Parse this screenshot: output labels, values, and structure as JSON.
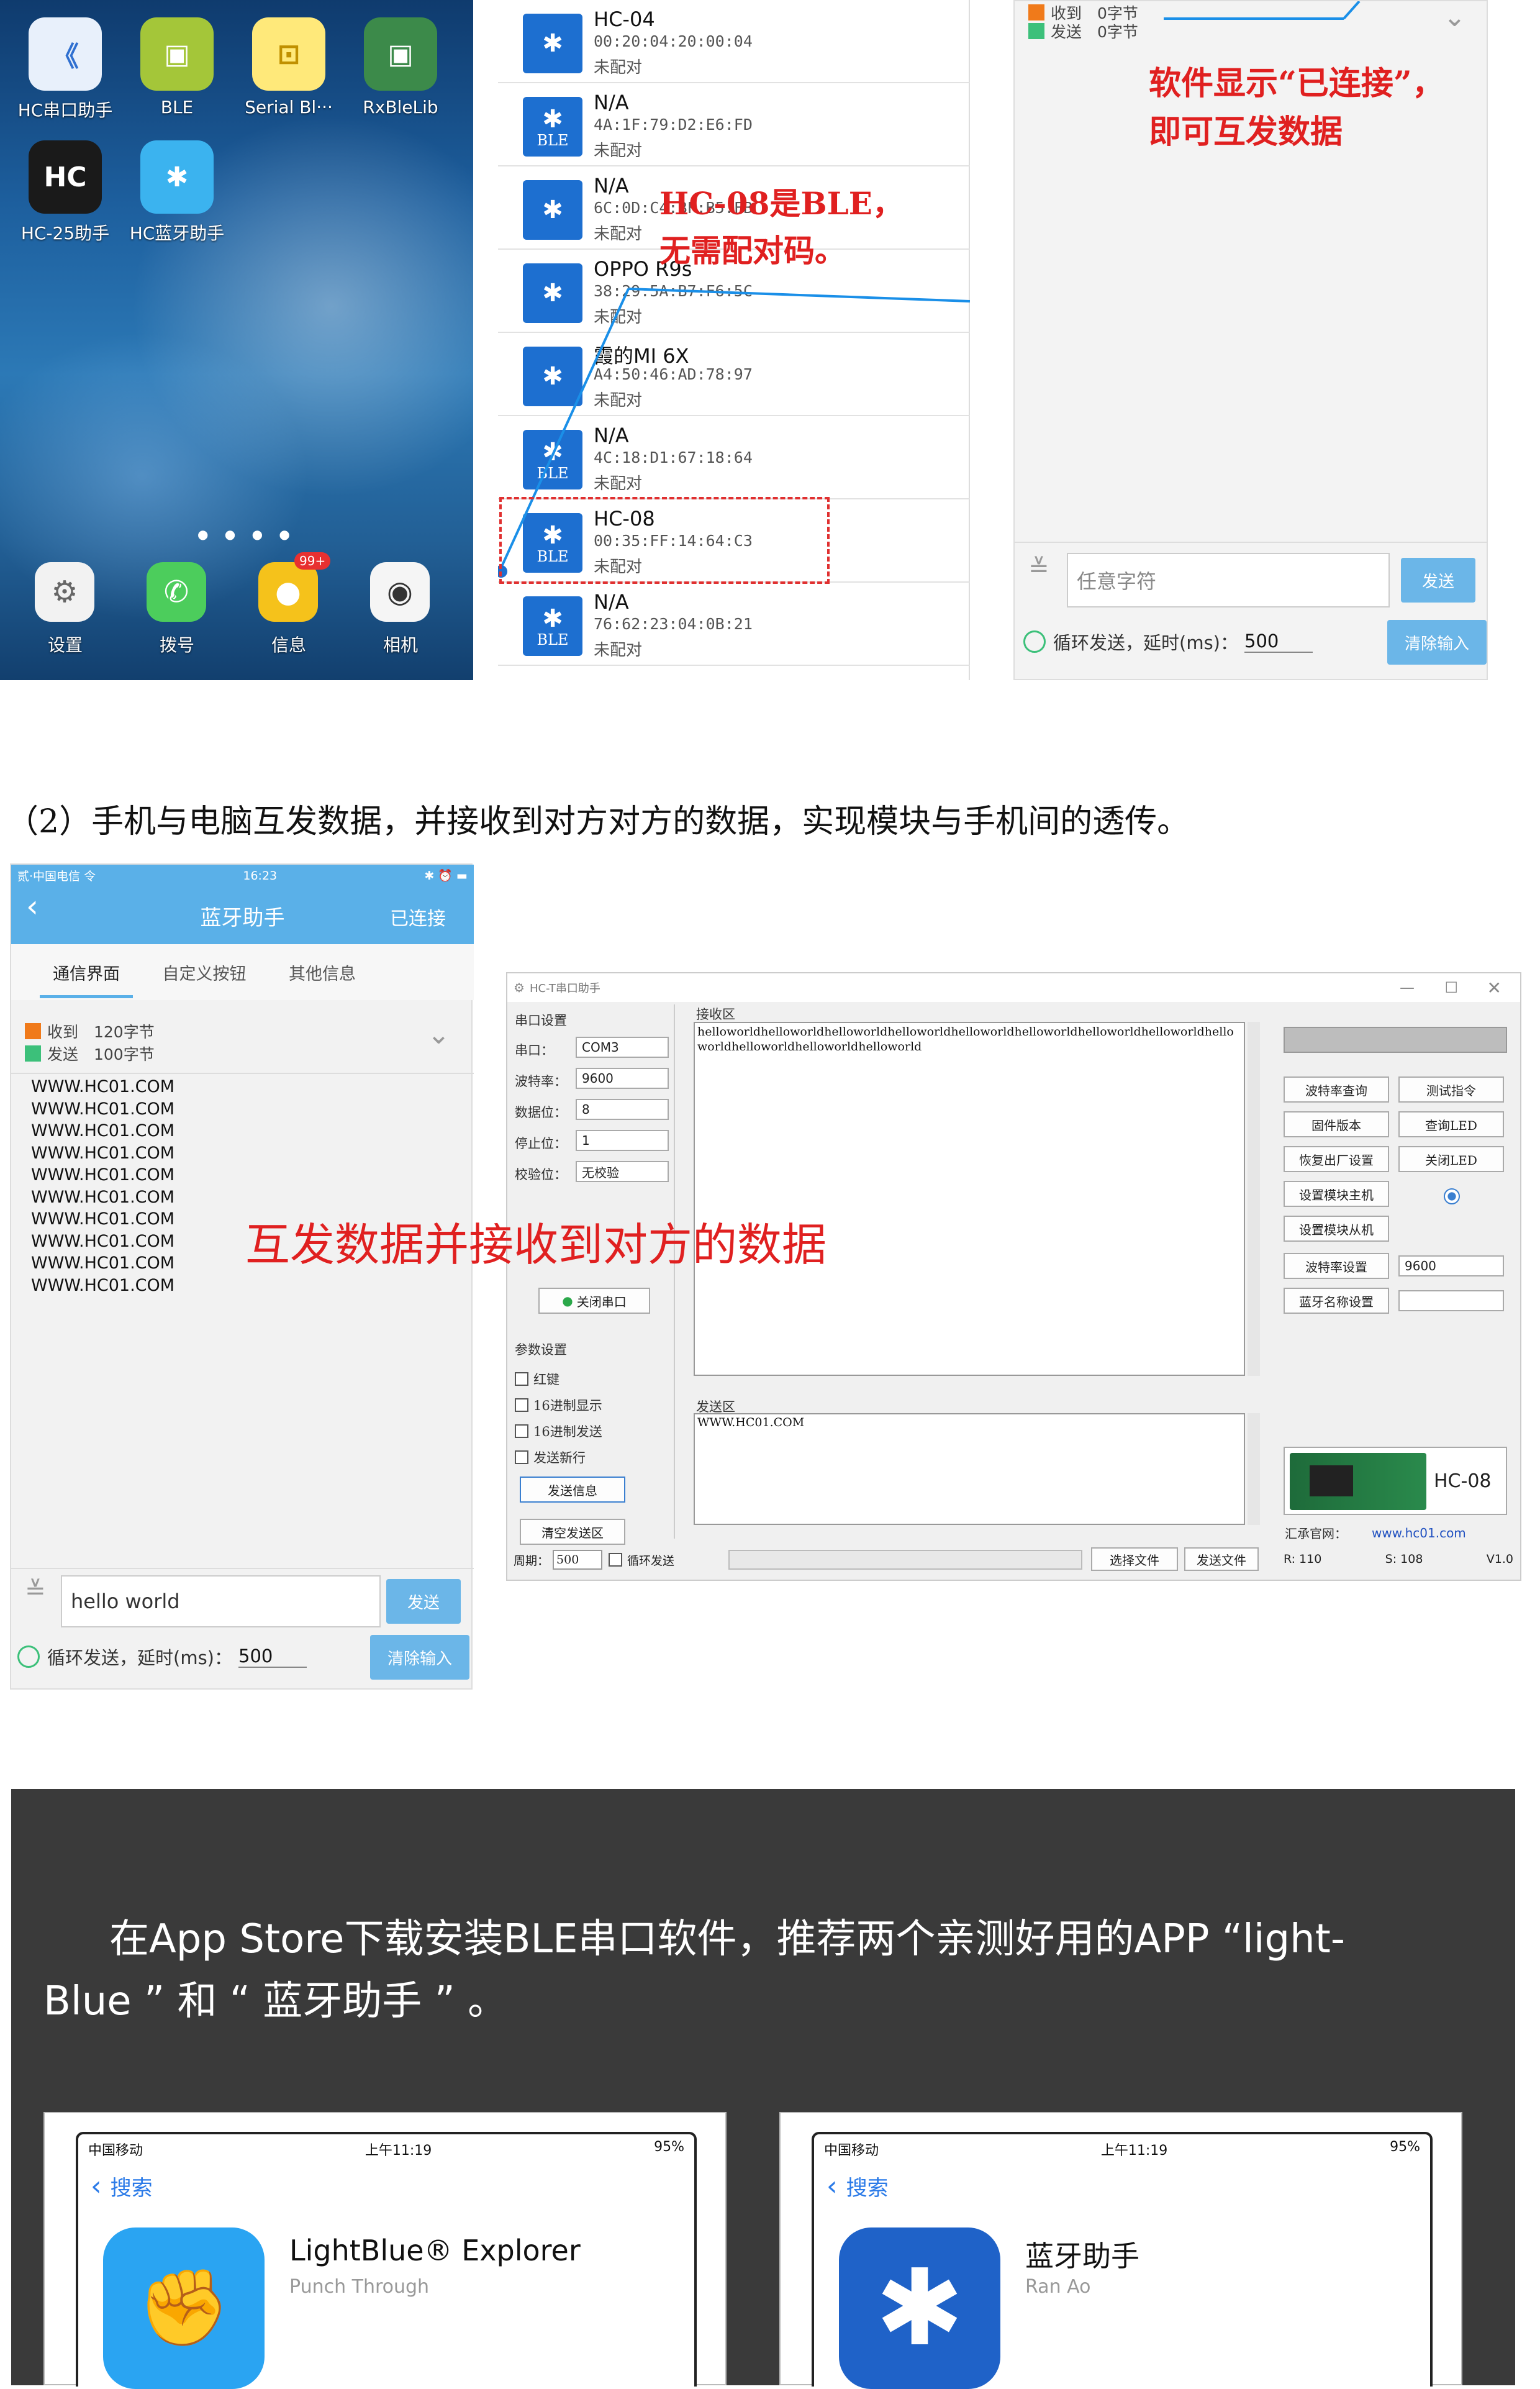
{
  "home": {
    "apps": [
      {
        "label": "HC串口助手",
        "icon": "hc-serial-icon",
        "color": "#e8f0fb"
      },
      {
        "label": "BLE",
        "icon": "android-ble-icon",
        "color": "#a4c639"
      },
      {
        "label": "Serial Bl···",
        "icon": "serial-bluetooth-icon",
        "color": "#ffe97a"
      },
      {
        "label": "RxBleLib",
        "icon": "android-rxblelib-icon",
        "color": "#3c8a4a"
      },
      {
        "label": "HC-25助手",
        "icon": "hc25-icon",
        "color": "#1a1a1a"
      },
      {
        "label": "HC蓝牙助手",
        "icon": "hc-bluetooth-icon",
        "color": "#3bb3ef"
      }
    ],
    "dock": [
      {
        "label": "设置",
        "icon": "settings-icon"
      },
      {
        "label": "拨号",
        "icon": "phone-icon"
      },
      {
        "label": "信息",
        "icon": "messages-icon",
        "badge": "99+"
      },
      {
        "label": "相机",
        "icon": "camera-icon"
      }
    ]
  },
  "device_list": {
    "devices": [
      {
        "name": "HC-04",
        "address": "00:20:04:20:00:04",
        "status": "未配对",
        "ble": false
      },
      {
        "name": "N/A",
        "address": "4A:1F:79:D2:E6:FD",
        "status": "未配对",
        "ble": true
      },
      {
        "name": "N/A",
        "address": "6C:0D:C4:BF:B5:FB",
        "status": "未配对",
        "ble": false
      },
      {
        "name": "OPPO R9s",
        "address": "38:29:5A:B7:F6:5C",
        "status": "未配对",
        "ble": false
      },
      {
        "name": "霞的MI 6X",
        "address": "A4:50:46:AD:78:97",
        "status": "未配对",
        "ble": false
      },
      {
        "name": "N/A",
        "address": "4C:18:D1:67:18:64",
        "status": "未配对",
        "ble": true
      },
      {
        "name": "HC-08",
        "address": "00:35:FF:14:64:C3",
        "status": "未配对",
        "ble": true
      },
      {
        "name": "N/A",
        "address": "76:62:23:04:0B:21",
        "status": "未配对",
        "ble": true
      }
    ],
    "callout_line1": "HC-08是BLE，",
    "callout_line2": "无需配对码。"
  },
  "top_chat": {
    "recv": "收到　0字节",
    "send": "发送　0字节",
    "callout_line1": "软件显示“已连接”，",
    "callout_line2": "即可互发数据",
    "input_placeholder": "任意字符",
    "send_button": "发送",
    "loop_label": "循环发送，延时(ms)：",
    "delay": "500",
    "clear_button": "清除输入"
  },
  "section2_caption": "（2）手机与电脑互发数据，并接收到对方对方的数据，实现模块与手机间的透传。",
  "phone_chat": {
    "status_left": "贰·中国电信 令",
    "status_time": "16:23",
    "title": "蓝牙助手",
    "back_icon": "back-arrow-icon",
    "connected": "已连接",
    "tabs": [
      "通信界面",
      "自定义按钮",
      "其他信息"
    ],
    "recv": "收到　120字节",
    "send": "发送　100字节",
    "lines": [
      "WWW.HC01.COM",
      "WWW.HC01.COM",
      "WWW.HC01.COM",
      "WWW.HC01.COM",
      "WWW.HC01.COM",
      "WWW.HC01.COM",
      "WWW.HC01.COM",
      "WWW.HC01.COM",
      "WWW.HC01.COM",
      "WWW.HC01.COM"
    ],
    "input_value": "hello world",
    "send_button": "发送",
    "loop_label": "循环发送，延时(ms)：",
    "delay": "500",
    "clear_button": "清除输入"
  },
  "serial_tool": {
    "title": "HC-T串口助手",
    "port_group": "串口设置",
    "port_label": "串口：",
    "port": "COM3",
    "baud_label": "波特率：",
    "baud": "9600",
    "data_label": "数据位：",
    "data": "8",
    "stop_label": "停止位：",
    "stop": "1",
    "parity_label": "校验位：",
    "parity": "无校验",
    "close_port": "关闭串口",
    "param_group": "参数设置",
    "checks": [
      "红键",
      "16进制显示",
      "16进制发送",
      "发送新行"
    ],
    "send_info": "发送信息",
    "clear_send": "清空发送区",
    "recv_label": "接收区",
    "recv_text": "helloworldhelloworldhelloworldhelloworldhelloworldhelloworldhelloworldhelloworldhelloworldhelloworldhelloworldhelloworld",
    "send_label": "发送区",
    "send_text": "WWW.HC01.COM",
    "right_buttons": [
      [
        "波特率查询",
        "测试指令"
      ],
      [
        "固件版本",
        "查询LED"
      ],
      [
        "恢复出厂设置",
        "关闭LED"
      ],
      [
        "设置模块主机",
        ""
      ],
      [
        "设置模块从机",
        ""
      ]
    ],
    "baud_set": "波特率设置",
    "baud_set_val": "9600",
    "name_set": "蓝牙名称设置",
    "module_name": "HC-08",
    "site_label": "汇承官网：",
    "site": "www.hc01.com",
    "period_label": "周期：",
    "period": "500",
    "loop_send": "循环发送",
    "select_file": "选择文件",
    "send_file": "发送文件",
    "r_count": "R: 110",
    "s_count": "S: 108",
    "version": "V1.0",
    "overlay": "互发数据并接收到对方的数据"
  },
  "dark_section": {
    "line1": "在App Store下载安装BLE串口软件，推荐两个亲测好用的APP “light-",
    "line2": "Blue ” 和 “ 蓝牙助手 ” 。"
  },
  "store_cards": [
    {
      "carrier": "中国移动",
      "time": "上午11:19",
      "battery": "95%",
      "back": "搜索",
      "app": "LightBlue® Explorer",
      "sub": "Punch Through",
      "icon": "lightblue-fist-icon"
    },
    {
      "carrier": "中国移动",
      "time": "上午11:19",
      "battery": "95%",
      "back": "搜索",
      "app": "蓝牙助手",
      "sub": "Ran Ao",
      "icon": "bluetooth-icon"
    }
  ]
}
